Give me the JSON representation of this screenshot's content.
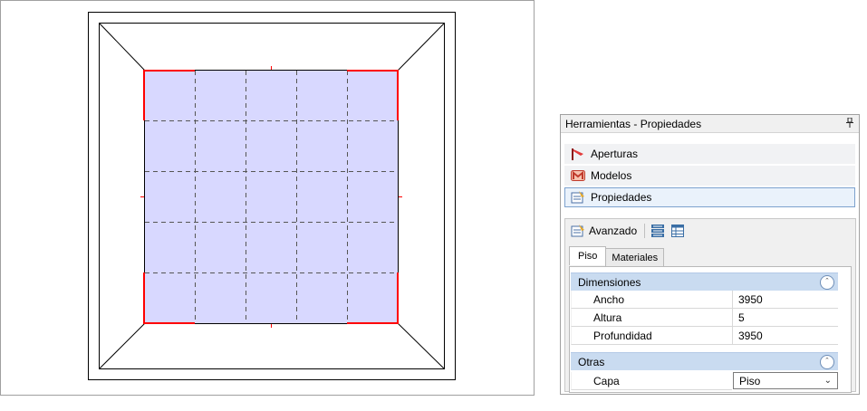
{
  "panel": {
    "title": "Herramientas - Propiedades",
    "pin_icon": "pin-icon",
    "nav": [
      {
        "label": "Aperturas",
        "icon": "openings-icon"
      },
      {
        "label": "Modelos",
        "icon": "models-icon"
      },
      {
        "label": "Propiedades",
        "icon": "properties-icon",
        "selected": true
      }
    ],
    "toolbar": {
      "advanced_label": "Avanzado",
      "icons": [
        "advanced-icon",
        "categorized-view-icon",
        "table-view-icon"
      ]
    },
    "tabs": [
      {
        "label": "Piso",
        "active": true
      },
      {
        "label": "Materiales",
        "active": false
      }
    ],
    "sections": {
      "dimensions": {
        "title": "Dimensiones",
        "rows": [
          {
            "name": "Ancho",
            "value": "3950"
          },
          {
            "name": "Altura",
            "value": "5"
          },
          {
            "name": "Profundidad",
            "value": "3950"
          }
        ]
      },
      "other": {
        "title": "Otras",
        "rows": [
          {
            "name": "Capa",
            "value": "Piso"
          }
        ]
      }
    }
  },
  "colors": {
    "floor_fill": "#d8d8ff",
    "highlight_edges": "#ff0000",
    "section_header": "#c9dbf0",
    "selection_border": "#7da2ce"
  }
}
